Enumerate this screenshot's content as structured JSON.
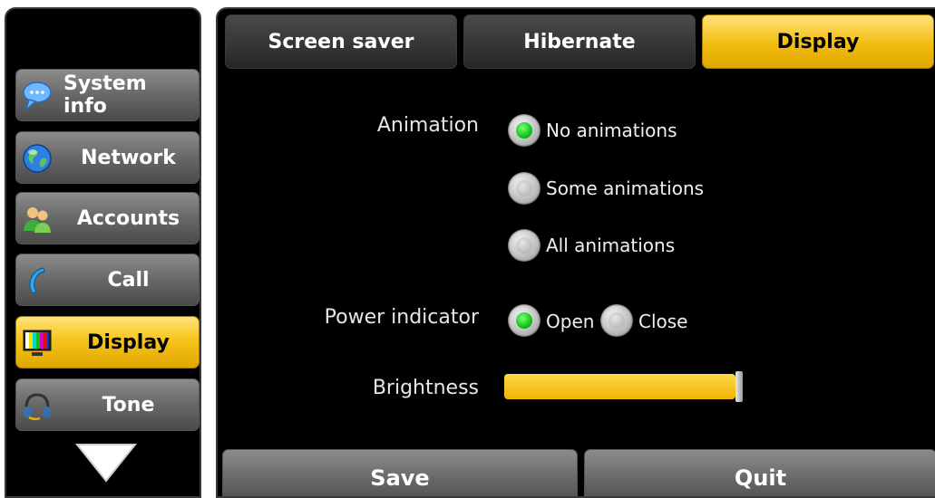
{
  "sidebar": {
    "items": [
      {
        "label": "System info",
        "icon": "chat-bubble-icon",
        "active": false
      },
      {
        "label": "Network",
        "icon": "globe-icon",
        "active": false
      },
      {
        "label": "Accounts",
        "icon": "users-icon",
        "active": false
      },
      {
        "label": "Call",
        "icon": "phone-handset-icon",
        "active": false
      },
      {
        "label": "Display",
        "icon": "monitor-icon",
        "active": true
      },
      {
        "label": "Tone",
        "icon": "headset-icon",
        "active": false
      }
    ],
    "more_icon": "triangle-down-icon"
  },
  "tabs": [
    {
      "label": "Screen saver",
      "active": false
    },
    {
      "label": "Hibernate",
      "active": false
    },
    {
      "label": "Display",
      "active": true
    }
  ],
  "settings": {
    "animation": {
      "label": "Animation",
      "options": [
        "No animations",
        "Some animations",
        "All animations"
      ],
      "selected": "No animations"
    },
    "power_indicator": {
      "label": "Power indicator",
      "options": [
        "Open",
        "Close"
      ],
      "selected": "Open"
    },
    "brightness": {
      "label": "Brightness",
      "value": 1.0
    }
  },
  "buttons": {
    "save": "Save",
    "quit": "Quit"
  },
  "colors": {
    "accent": "#f3bd10",
    "radio_checked": "#10c21a",
    "background": "#000000"
  }
}
